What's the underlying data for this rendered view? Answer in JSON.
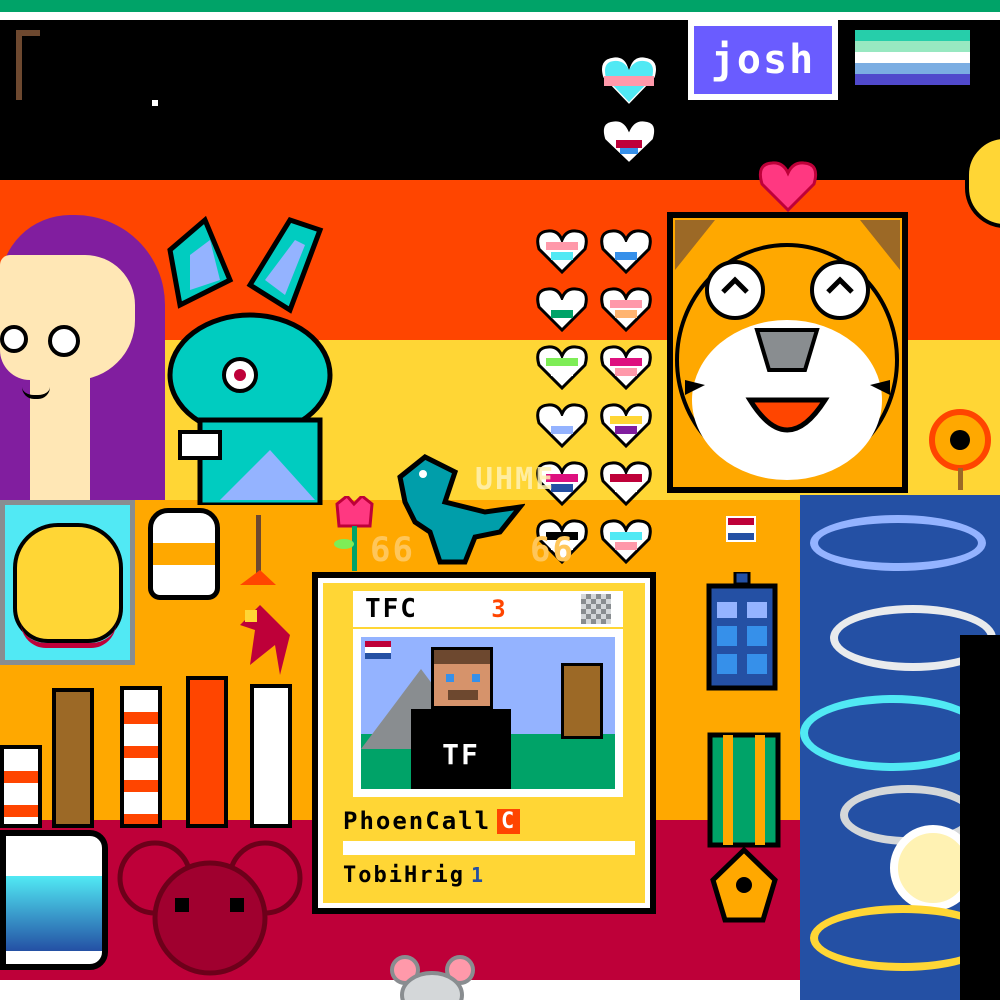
{
  "canvas": {
    "flag_colors": [
      "#000000",
      "#ff4500",
      "#ffd635",
      "#ffa800",
      "#be0039"
    ],
    "right_bg": "#2450a4"
  },
  "tags": {
    "josh_badge": "josh",
    "faint_text": "UHME",
    "faint_numbers_left": "66",
    "faint_numbers_right": "66"
  },
  "trading_card": {
    "header": "TFC",
    "header_badge": "3",
    "name": "PhoenCall",
    "name_badge": "C",
    "subtitle": "TobiHrig",
    "subtitle_badge": "1",
    "shirt_logo": "TF"
  },
  "pride_flag_mini": {
    "colors": [
      "#26ceaa",
      "#98e8c1",
      "#ffffff",
      "#7bade2",
      "#5049cc"
    ]
  },
  "hearts": [
    {
      "top": "#ff99aa",
      "bottom": "#51e9f4"
    },
    {
      "top": "#ffffff",
      "bottom": "#3690ea"
    },
    {
      "top": "#ffffff",
      "bottom": "#00a368"
    },
    {
      "top": "#ff99aa",
      "bottom": "#ffb470"
    },
    {
      "top": "#7eed56",
      "bottom": "#ffffff"
    },
    {
      "top": "#de107f",
      "bottom": "#ff99aa"
    },
    {
      "top": "#ffffff",
      "bottom": "#94b3ff"
    },
    {
      "top": "#ffd635",
      "bottom": "#811e9f"
    },
    {
      "top": "#de107f",
      "bottom": "#2450a4"
    },
    {
      "top": "#be0039",
      "bottom": "#ffffff"
    },
    {
      "top": "#000000",
      "bottom": "#ffffff"
    },
    {
      "top": "#51e9f4",
      "bottom": "#ff99aa"
    }
  ],
  "icon_names": [
    "tiger-face",
    "teal-rabbit",
    "purple-hair-girl",
    "godzilla-sprite",
    "tardis-icon",
    "medal-icon",
    "lighthouse-icon",
    "starry-night-art",
    "mouse-face"
  ]
}
